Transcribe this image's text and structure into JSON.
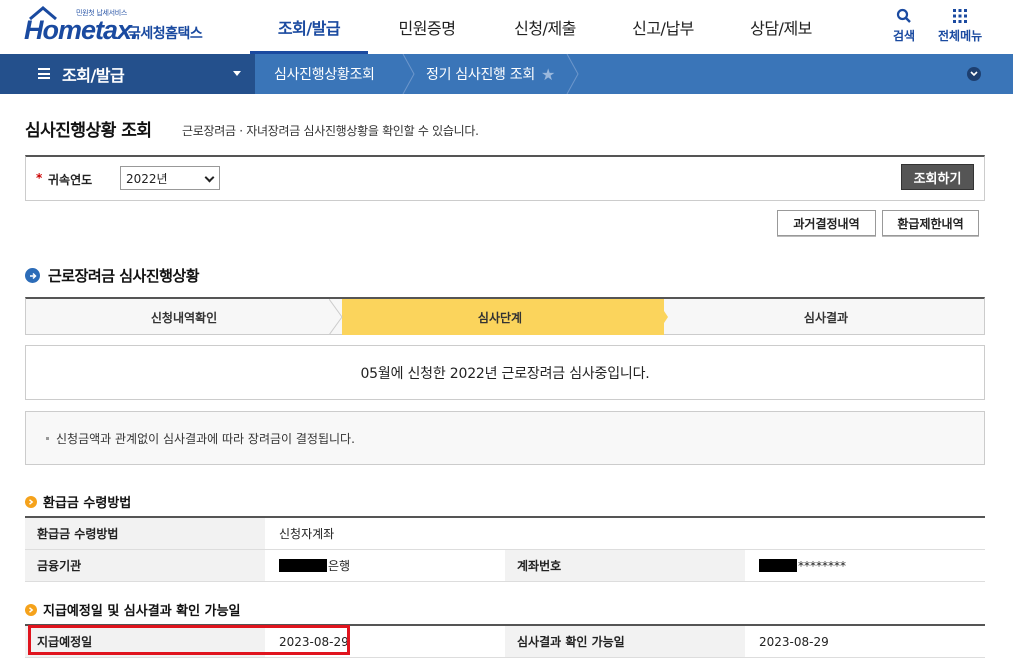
{
  "header": {
    "logo_tagline": "민원첫 납세서비스",
    "logo_text": "Hometax.",
    "logo_kr": "국세청홈택스",
    "nav": [
      "조회/발급",
      "민원증명",
      "신청/제출",
      "신고/납부",
      "상담/제보"
    ],
    "active_nav": "조회/발급",
    "search_label": "검색",
    "menu_label": "전체메뉴",
    "brand_color": "#1a4aa0"
  },
  "locbar": {
    "root": "조회/발급",
    "crumb1": "심사진행상황조회",
    "crumb2": "정기 심사진행 조회"
  },
  "page": {
    "title": "심사진행상황 조회",
    "desc": "근로장려금 · 자녀장려금 심사진행상황을 확인할 수 있습니다."
  },
  "search": {
    "required_mark": "*",
    "label": "귀속연도",
    "year_value": "2022년",
    "submit_label": "조회하기"
  },
  "buttons": {
    "history": "과거결정내역",
    "refund_limit": "환급제한내역"
  },
  "section": {
    "title": "근로장려금 심사진행상황",
    "steps": [
      "신청내역확인",
      "심사단계",
      "심사결과"
    ],
    "active_step": "심사단계",
    "status_message": "05월에 신청한 2022년 근로장려금 심사중입니다.",
    "note": "신청금액과 관계없이 심사결과에 따라 장려금이 결정됩니다."
  },
  "refund": {
    "title": "환급금 수령방법",
    "method_label": "환급금 수령방법",
    "method_value": "신청자계좌",
    "bank_label": "금융기관",
    "bank_suffix": "은행",
    "account_label": "계좌번호",
    "account_suffix": "********"
  },
  "schedule": {
    "title": "지급예정일 및 심사결과 확인 가능일",
    "pay_date_label": "지급예정일",
    "pay_date_value": "2023-08-29",
    "result_date_label": "심사결과 확인 가능일",
    "result_date_value": "2023-08-29"
  }
}
